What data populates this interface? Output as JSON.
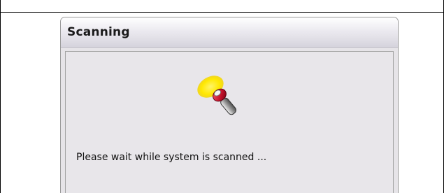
{
  "dialog": {
    "title": "Scanning",
    "message": "Please wait while system is scanned ...",
    "icon": "flashlight-scan-icon",
    "colors": {
      "beam": "#ffe800",
      "flashlight_red": "#c0102a",
      "flashlight_metal": "#8a8a8a"
    }
  }
}
